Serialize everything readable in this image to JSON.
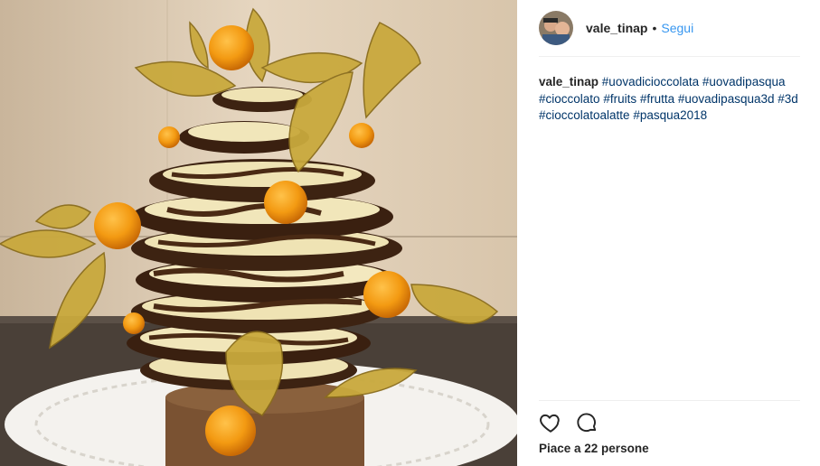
{
  "post": {
    "username": "vale_tinap",
    "separator": "•",
    "follow_label": "Segui",
    "caption_user": "vale_tinap",
    "hashtags": [
      "#uovadicioccolata",
      "#uovadipasqua",
      "#cioccolato",
      "#fruits",
      "#frutta",
      "#uovadipasqua3d",
      "#3d",
      "#cioccolatoalatte",
      "#pasqua2018"
    ],
    "likes_text": "Piace a 22 persone"
  },
  "icons": {
    "like": "heart-outline-icon",
    "comment": "speech-bubble-icon"
  },
  "colors": {
    "link": "#3897f0",
    "text": "#262626",
    "hashtag": "#003569"
  }
}
